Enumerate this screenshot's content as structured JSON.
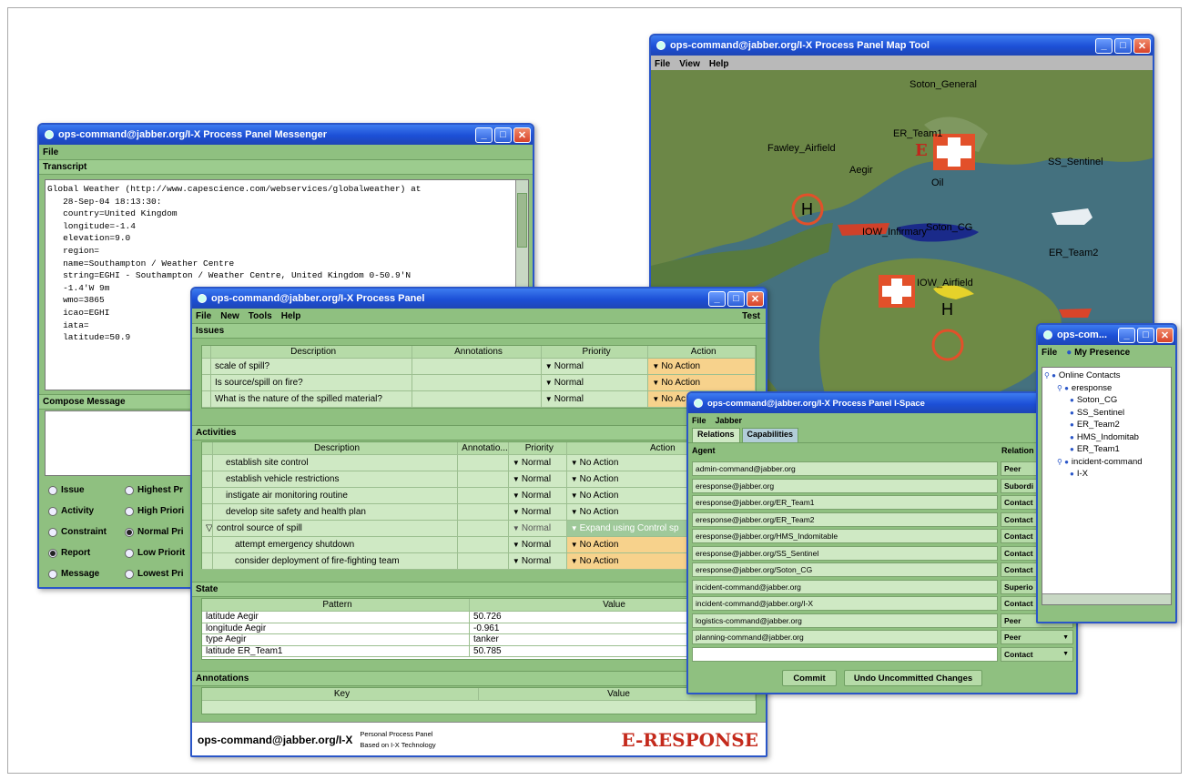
{
  "messenger": {
    "title": "ops-command@jabber.org/I-X Process Panel Messenger",
    "menu": [
      "File"
    ],
    "transcript_label": "Transcript",
    "transcript_lines": [
      "Global Weather (http://www.capescience.com/webservices/globalweather) at",
      "   28-Sep-04 18:13:30:",
      "   country=United Kingdom",
      "   longitude=-1.4",
      "   elevation=9.0",
      "   region=",
      "   name=Southampton / Weather Centre",
      "   string=EGHI - Southampton / Weather Centre, United Kingdom 0-50.9'N",
      "   -1.4'W 9m",
      "   wmo=3865",
      "   icao=EGHI",
      "   iata=",
      "   latitude=50.9"
    ],
    "compose_label": "Compose Message",
    "radios": [
      {
        "label": "Issue",
        "checked": false
      },
      {
        "label": "Highest Pr",
        "checked": false
      },
      {
        "label": "Activity",
        "checked": false
      },
      {
        "label": "High Priori",
        "checked": false
      },
      {
        "label": "Constraint",
        "checked": false
      },
      {
        "label": "Normal Pri",
        "checked": true
      },
      {
        "label": "Report",
        "checked": true
      },
      {
        "label": "Low Priorit",
        "checked": false
      },
      {
        "label": "Message",
        "checked": false
      },
      {
        "label": "Lowest Pri",
        "checked": false
      }
    ]
  },
  "map": {
    "title": "ops-command@jabber.org/I-X Process Panel Map Tool",
    "menu": [
      "File",
      "View",
      "Help"
    ],
    "labels": {
      "soton_general": "Soton_General",
      "er_team1": "ER_Team1",
      "fawley": "Fawley_Airfield",
      "aegir": "Aegir",
      "oil": "Oil",
      "ss_sentinel": "SS_Sentinel",
      "iow_infirmary": "IOW_Infirmary",
      "soton_cg": "Soton_CG",
      "er_team2": "ER_Team2",
      "iow_airfield": "IOW_Airfield",
      "e_marker": "E",
      "h_marker": "H"
    },
    "colors": {
      "sea": "#3f6a7c",
      "land": "#6f8a4a",
      "marker": "#e2502a"
    }
  },
  "panel": {
    "title": "ops-command@jabber.org/I-X Process Panel",
    "menu": [
      "File",
      "New",
      "Tools",
      "Help"
    ],
    "menu_right": "Test",
    "issues_label": "Issues",
    "issues_headers": [
      "Description",
      "Annotations",
      "Priority",
      "Action"
    ],
    "issues": [
      {
        "desc": "scale of spill?",
        "ann": "",
        "priority": "Normal",
        "action": "No Action"
      },
      {
        "desc": "Is source/spill on fire?",
        "ann": "",
        "priority": "Normal",
        "action": "No Action"
      },
      {
        "desc": "What is the nature of the spilled material?",
        "ann": "",
        "priority": "Normal",
        "action": "No Ac"
      }
    ],
    "activities_label": "Activities",
    "activities_headers": [
      "Description",
      "Annotatio...",
      "Priority",
      "Action"
    ],
    "activities": [
      {
        "desc": "establish site control",
        "priority": "Normal",
        "action": "No Action",
        "hl": false,
        "exp": ""
      },
      {
        "desc": "establish vehicle restrictions",
        "priority": "Normal",
        "action": "No Action",
        "hl": false,
        "exp": ""
      },
      {
        "desc": "instigate air monitoring routine",
        "priority": "Normal",
        "action": "No Action",
        "hl": false,
        "exp": ""
      },
      {
        "desc": "develop site safety and health plan",
        "priority": "Normal",
        "action": "No Action",
        "hl": false,
        "exp": ""
      },
      {
        "desc": "control source of spill",
        "priority": "Normal",
        "action": "Expand using Control sp",
        "hl": false,
        "exp": "▽"
      },
      {
        "desc": "attempt emergency shutdown",
        "priority": "Normal",
        "action": "No Action",
        "hl": true,
        "exp": ""
      },
      {
        "desc": "consider deployment of fire-fighting team",
        "priority": "Normal",
        "action": "No Action",
        "hl": true,
        "exp": ""
      }
    ],
    "state_label": "State",
    "state_headers": [
      "Pattern",
      "Value"
    ],
    "state": [
      {
        "pattern": "latitude Aegir",
        "value": "50.726"
      },
      {
        "pattern": "longitude Aegir",
        "value": "-0.961"
      },
      {
        "pattern": "type Aegir",
        "value": "tanker"
      },
      {
        "pattern": "latitude ER_Team1",
        "value": "50.785"
      }
    ],
    "annotations_label": "Annotations",
    "annotations_headers": [
      "Key",
      "Value"
    ],
    "footer_id": "ops-command@jabber.org/I-X",
    "footer_line1": "Personal Process Panel",
    "footer_line2": "Based on I-X Technology",
    "footer_logo": "E-RESPONSE"
  },
  "ispace": {
    "title": "ops-command@jabber.org/I-X Process Panel I-Space",
    "menu": [
      "File",
      "Jabber"
    ],
    "tabs": [
      "Relations",
      "Capabilities"
    ],
    "agent_header": "Agent",
    "relation_header": "Relation",
    "rows": [
      {
        "agent": "admin-command@jabber.org",
        "rel": "Peer"
      },
      {
        "agent": "eresponse@jabber.org",
        "rel": "Subordi"
      },
      {
        "agent": "eresponse@jabber.org/ER_Team1",
        "rel": "Contact"
      },
      {
        "agent": "eresponse@jabber.org/ER_Team2",
        "rel": "Contact"
      },
      {
        "agent": "eresponse@jabber.org/HMS_Indomitable",
        "rel": "Contact"
      },
      {
        "agent": "eresponse@jabber.org/SS_Sentinel",
        "rel": "Contact"
      },
      {
        "agent": "eresponse@jabber.org/Soton_CG",
        "rel": "Contact"
      },
      {
        "agent": "incident-command@jabber.org",
        "rel": "Superio"
      },
      {
        "agent": "incident-command@jabber.org/I-X",
        "rel": "Contact"
      },
      {
        "agent": "logistics-command@jabber.org",
        "rel": "Peer"
      },
      {
        "agent": "planning-command@jabber.org",
        "rel": "Peer"
      },
      {
        "agent": "",
        "rel": "Contact"
      }
    ],
    "commit": "Commit",
    "undo": "Undo Uncommitted Changes"
  },
  "presence": {
    "title": "ops-com...",
    "menu": [
      "File",
      "My Presence"
    ],
    "tree": [
      {
        "label": "Online Contacts",
        "level": 0
      },
      {
        "label": "eresponse",
        "level": 1
      },
      {
        "label": "Soton_CG",
        "level": 2
      },
      {
        "label": "SS_Sentinel",
        "level": 2
      },
      {
        "label": "ER_Team2",
        "level": 2
      },
      {
        "label": "HMS_Indomitab",
        "level": 2
      },
      {
        "label": "ER_Team1",
        "level": 2
      },
      {
        "label": "incident-command",
        "level": 1
      },
      {
        "label": "I-X",
        "level": 2
      }
    ]
  }
}
